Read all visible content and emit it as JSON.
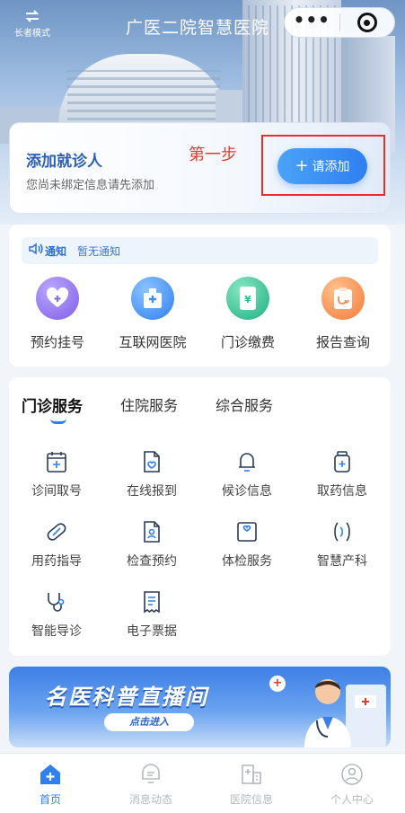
{
  "header": {
    "mode_label": "长者模式",
    "title": "广医二院智慧医院",
    "more_icon": "more-dots-icon",
    "close_icon": "target-close-icon"
  },
  "patient_card": {
    "title": "添加就诊人",
    "subtitle": "您尚未绑定信息请先添加",
    "add_button": "请添加",
    "annotation": "第一步"
  },
  "notice": {
    "label": "通知",
    "text": "暂无通知"
  },
  "quick_actions": [
    {
      "label": "预约挂号",
      "icon": "heart-plus-icon",
      "color": "#8b6fe8"
    },
    {
      "label": "互联网医院",
      "icon": "hospital-building-icon",
      "color": "#3f8df0"
    },
    {
      "label": "门诊缴费",
      "icon": "payment-phone-icon",
      "color": "#2fbf8f"
    },
    {
      "label": "报告查询",
      "icon": "report-clipboard-icon",
      "color": "#f58a4a"
    }
  ],
  "services": {
    "tabs": [
      "门诊服务",
      "住院服务",
      "综合服务"
    ],
    "items": [
      {
        "label": "诊间取号",
        "icon": "calendar-plus-icon"
      },
      {
        "label": "在线报到",
        "icon": "document-heart-icon"
      },
      {
        "label": "候诊信息",
        "icon": "bell-icon"
      },
      {
        "label": "取药信息",
        "icon": "medicine-bottle-icon"
      },
      {
        "label": "用药指导",
        "icon": "pill-icon"
      },
      {
        "label": "检查预约",
        "icon": "document-person-icon"
      },
      {
        "label": "体检服务",
        "icon": "checkup-frame-icon"
      },
      {
        "label": "智慧产科",
        "icon": "maternity-icon"
      },
      {
        "label": "智能导诊",
        "icon": "stethoscope-icon"
      },
      {
        "label": "电子票据",
        "icon": "receipt-icon"
      }
    ]
  },
  "banner": {
    "title": "名医科普直播间",
    "button": "点击进入"
  },
  "tabbar": [
    {
      "label": "首页",
      "icon": "home-plus-icon",
      "active": true
    },
    {
      "label": "消息动态",
      "icon": "message-bubble-icon",
      "active": false
    },
    {
      "label": "医院信息",
      "icon": "hospital-info-icon",
      "active": false
    },
    {
      "label": "个人中心",
      "icon": "user-profile-icon",
      "active": false
    }
  ]
}
